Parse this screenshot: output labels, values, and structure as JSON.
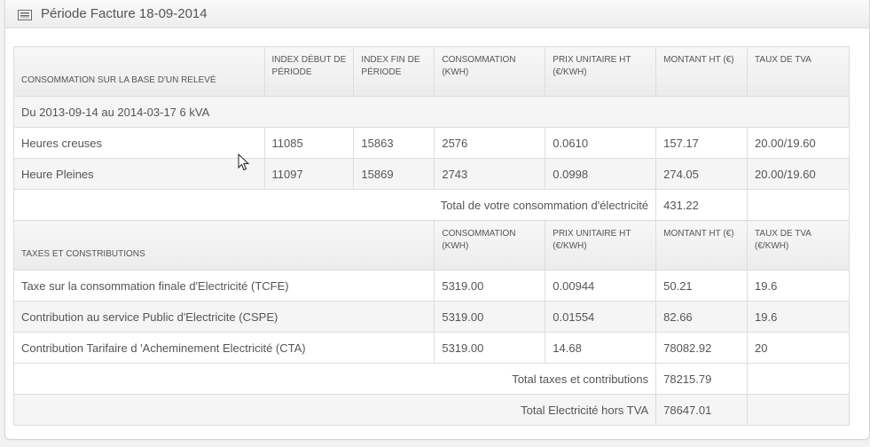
{
  "header": {
    "title": "Période Facture 18-09-2014",
    "icon": "list-icon"
  },
  "consumption": {
    "headers": [
      "CONSOMMATION SUR LA BASE D'UN RELEVÉ",
      "INDEX DÉBUT DE PÉRIODE",
      "INDEX FIN DE PÉRIODE",
      "CONSOMMATION (KWH)",
      "PRIX UNITAIRE HT (€/KWH)",
      "MONTANT HT (€)",
      "TAUX DE TVA"
    ],
    "period_label": "Du 2013-09-14 au 2014-03-17 6 kVA",
    "rows": [
      [
        "Heures creuses",
        "11085",
        "15863",
        "2576",
        "0.0610",
        "157.17",
        "20.00/19.60"
      ],
      [
        "Heure Pleines",
        "11097",
        "15869",
        "2743",
        "0.0998",
        "274.05",
        "20.00/19.60"
      ]
    ],
    "total_label": "Total de votre consommation d'électricité",
    "total_value": "431.22"
  },
  "taxes": {
    "headers": [
      "TAXES ET CONSTRIBUTIONS",
      "CONSOMMATION (KWH)",
      "PRIX UNITAIRE HT (€/KWH)",
      "MONTANT HT (€)",
      "TAUX DE TVA (€/KWH)"
    ],
    "rows": [
      [
        "Taxe sur la consommation finale d'Electricité (TCFE)",
        "5319.00",
        "0.00944",
        "50.21",
        "19.6"
      ],
      [
        "Contribution au service Public d'Electricite (CSPE)",
        "5319.00",
        "0.01554",
        "82.66",
        "19.6"
      ],
      [
        "Contribution Tarifaire d 'Acheminement Electricité (CTA)",
        "5319.00",
        "14.68",
        "78082.92",
        "20"
      ]
    ],
    "total_taxes_label": "Total taxes et contributions",
    "total_taxes_value": "78215.79",
    "total_ht_label": "Total Electricité hors TVA",
    "total_ht_value": "78647.01"
  }
}
